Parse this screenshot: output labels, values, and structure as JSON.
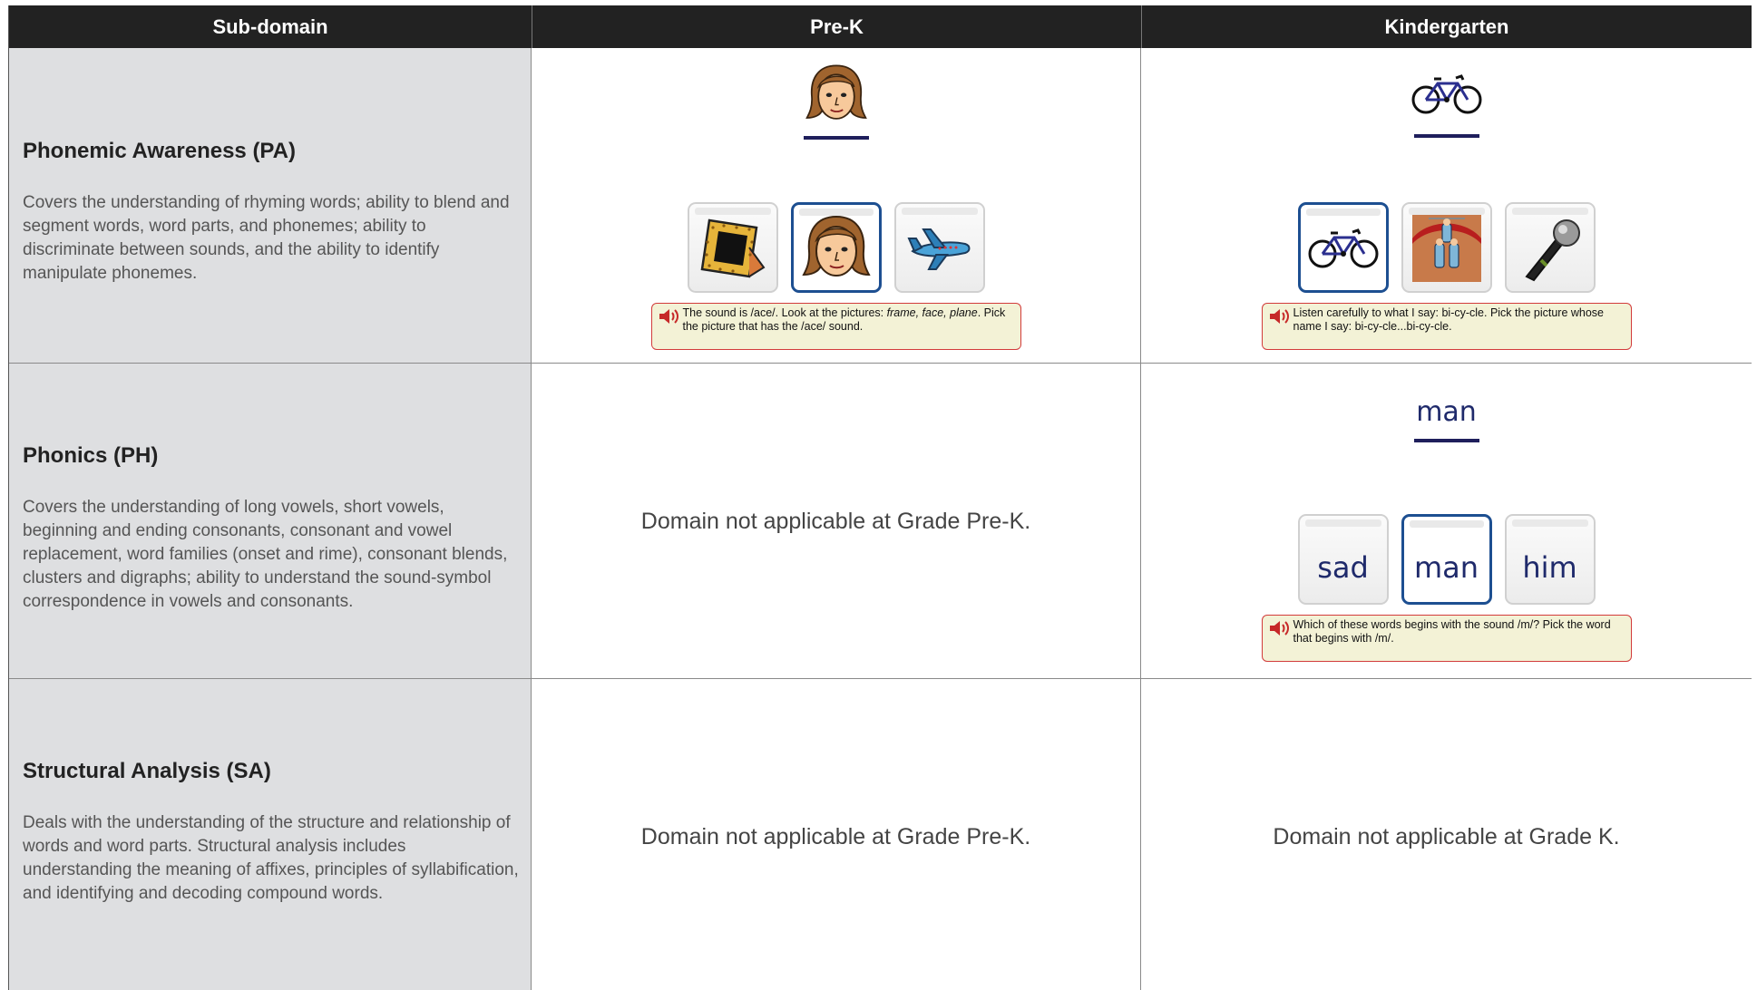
{
  "header": {
    "col1": "Sub-domain",
    "col2": "Pre-K",
    "col3": "Kindergarten"
  },
  "rows": [
    {
      "title": "Phonemic Awareness (PA)",
      "description": "Covers the understanding of rhyming words; ability to blend and segment words, word parts, and phonemes; ability to discriminate between sounds, and the ability to identify manipulate phonemes.",
      "prek": {
        "target_icon": "face-icon",
        "choices": [
          "frame-icon",
          "face-icon",
          "airplane-icon"
        ],
        "prompt_parts": [
          "The sound is /ace/. Look at the pictures: ",
          "frame, face, plane",
          ". Pick the picture that has the /ace/ sound."
        ]
      },
      "k": {
        "target_icon": "bicycle-icon",
        "choices": [
          "bicycle-icon",
          "acrobats-icon",
          "microphone-icon"
        ],
        "prompt": "Listen carefully to what I say: bi-cy-cle. Pick the picture whose name I say: bi-cy-cle...bi-cy-cle."
      }
    },
    {
      "title": "Phonics (PH)",
      "description": "Covers the understanding of long vowels, short vowels, beginning and ending consonants, consonant and vowel replacement, word families (onset and rime), consonant blends, clusters and digraphs; ability to understand the sound-symbol correspondence in vowels and consonants.",
      "prek": {
        "not_applicable": "Domain not applicable at Grade Pre-K."
      },
      "k": {
        "target_word": "man",
        "choices": [
          "sad",
          "man",
          "him"
        ],
        "prompt": "Which of these words begins with the sound /m/? Pick the word that begins with /m/."
      }
    },
    {
      "title": "Structural Analysis (SA)",
      "description": "Deals with the understanding of the structure and relationship of words and word parts. Structural analysis includes understanding the meaning of affixes, principles of syllabification, and identifying and decoding compound words.",
      "prek": {
        "not_applicable": "Domain not applicable at Grade Pre-K."
      },
      "k": {
        "not_applicable": "Domain not applicable at Grade K."
      }
    }
  ],
  "colors": {
    "header_bg": "#222222",
    "subdomain_bg": "#dedfe1",
    "selected_border": "#1d4f91",
    "prompt_border": "#d23b3b",
    "prompt_bg": "#f3f2d6"
  }
}
